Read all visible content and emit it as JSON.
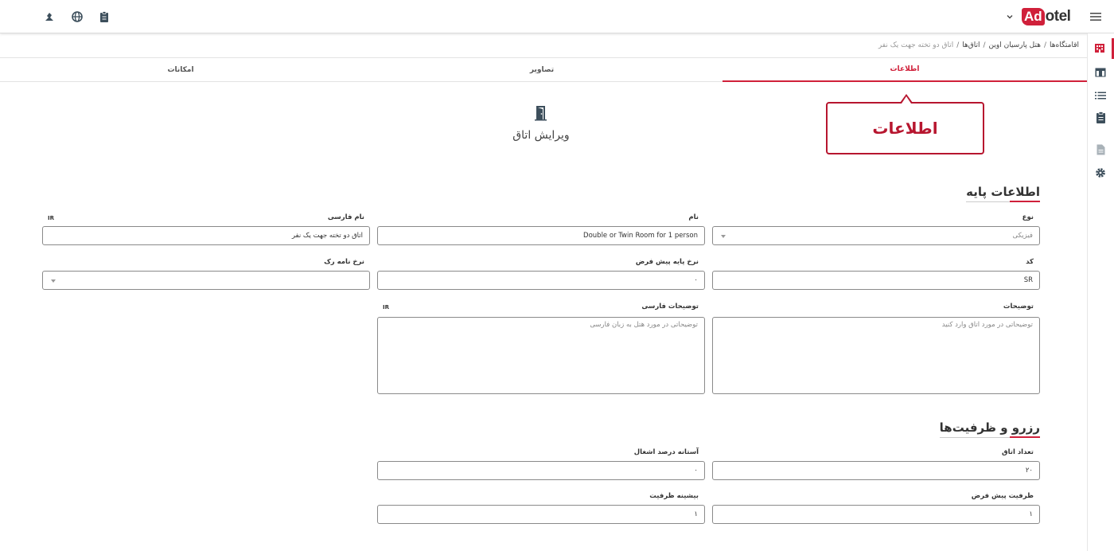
{
  "topbar": {
    "logo_mark": "Ad",
    "logo_rest": "otel",
    "left_icons": [
      "voice-icon",
      "globe-icon",
      "clipboard-icon"
    ],
    "right_icons": [
      "chevron-down-icon",
      "menu-icon"
    ]
  },
  "sidebar": {
    "icons": [
      "hotel-icon",
      "table-icon",
      "list-icon",
      "clipboard-icon",
      "document-icon",
      "gear-icon"
    ]
  },
  "breadcrumb": {
    "items": [
      "اقامتگاه‌ها",
      "هتل پارسیان اوین",
      "اتاق‌ها"
    ],
    "current": "اتاق دو تخته جهت یک نفر"
  },
  "tabs": [
    {
      "label": "اطلاعات"
    },
    {
      "label": "تصاویر"
    },
    {
      "label": "امکانات"
    }
  ],
  "callout": {
    "text": "اطلاعات"
  },
  "page": {
    "title": "ویرایش اتاق",
    "icon": "door-icon"
  },
  "sections": {
    "basic": "اطلاعات پایه",
    "capacity": "رزرو و ظرفیت‌ها"
  },
  "fields": {
    "type": {
      "label": "نوع",
      "value": "فیزیکی"
    },
    "name": {
      "label": "نام",
      "value": "Double or Twin Room for 1 person"
    },
    "name_fa": {
      "label": "نام فارسی",
      "value": "اتاق دو تخته جهت یک نفر",
      "tag": "IR"
    },
    "code": {
      "label": "کد",
      "value": "SR"
    },
    "base_rate": {
      "label": "نرخ پایه پیش فرض",
      "value": "۰"
    },
    "rate_card": {
      "label": "نرخ نامه رک",
      "value": ""
    },
    "desc": {
      "label": "توضیحات",
      "placeholder": "توضیحاتی در مورد اتاق وارد کنید"
    },
    "desc_fa": {
      "label": "توضیحات فارسی",
      "placeholder": "توضیحاتی در مورد هتل به زبان فارسی",
      "tag": "IR"
    },
    "room_count": {
      "label": "تعداد اتاق",
      "value": "۲۰"
    },
    "occupancy": {
      "label": "آستانه درصد اشغال",
      "value": "۰"
    },
    "default_capacity": {
      "label": "ظرفیت پیش فرض",
      "value": "۱"
    },
    "max_capacity": {
      "label": "بیشینه ظرفیت",
      "value": "۱"
    }
  }
}
